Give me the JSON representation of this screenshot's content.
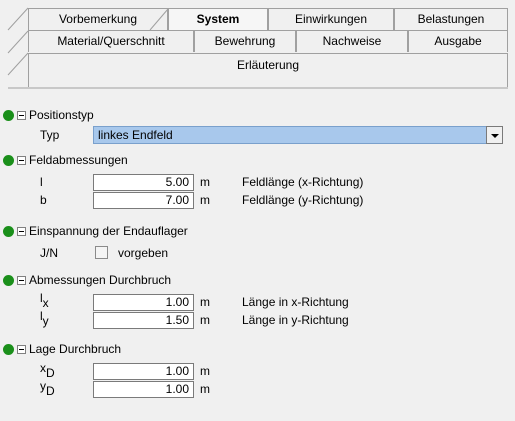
{
  "tabs": {
    "row1": [
      "Vorbemerkung",
      "System",
      "Einwirkungen",
      "Belastungen"
    ],
    "row2": [
      "Material/Querschnitt",
      "Bewehrung",
      "Nachweise",
      "Ausgabe"
    ],
    "row3": [
      "Erläuterung"
    ],
    "selected": "System"
  },
  "sections": {
    "positionstyp": {
      "title": "Positionstyp",
      "typ_label": "Typ",
      "typ_value": "linkes Endfeld"
    },
    "feld": {
      "title": "Feldabmessungen",
      "l_label": "l",
      "l_value": "5.00",
      "l_unit": "m",
      "l_desc": "Feldlänge (x-Richtung)",
      "b_label": "b",
      "b_value": "7.00",
      "b_unit": "m",
      "b_desc": "Feldlänge (y-Richtung)"
    },
    "einspannung": {
      "title": "Einspannung der Endauflager",
      "jn_label": "J/N",
      "checkbox_label": "vorgeben"
    },
    "durchbruch": {
      "title": "Abmessungen Durchbruch",
      "lx_label": "l",
      "lx_sub": "x",
      "lx_value": "1.00",
      "lx_unit": "m",
      "lx_desc": "Länge in x-Richtung",
      "ly_label": "l",
      "ly_sub": "y",
      "ly_value": "1.50",
      "ly_unit": "m",
      "ly_desc": "Länge in y-Richtung"
    },
    "lage": {
      "title": "Lage Durchbruch",
      "xd_label": "x",
      "xd_sub": "D",
      "xd_value": "1.00",
      "xd_unit": "m",
      "yd_label": "y",
      "yd_sub": "D",
      "yd_value": "1.00",
      "yd_unit": "m"
    }
  },
  "colors": {
    "dot": "#1a8f1a",
    "combo_bg": "#a8c8ec"
  }
}
